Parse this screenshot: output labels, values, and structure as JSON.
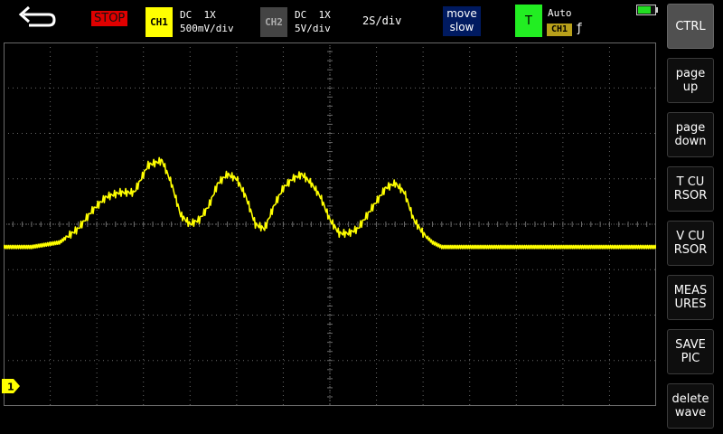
{
  "status": {
    "run_state": "STOP",
    "battery_level": 0.8
  },
  "ch1": {
    "label": "CH1",
    "coupling": "DC  1X",
    "scale": "500mV/div",
    "color": "#ffff00",
    "marker": "1"
  },
  "ch2": {
    "label": "CH2",
    "coupling": "DC  1X",
    "scale": "5V/div",
    "color": "#444444"
  },
  "timebase": "2S/div",
  "move_speed": {
    "line1": "move",
    "line2": "slow"
  },
  "trigger": {
    "badge": "T",
    "mode": "Auto",
    "source": "CH1",
    "edge": "ƒ"
  },
  "sidebar": {
    "items": [
      {
        "label": "CTRL",
        "active": true
      },
      {
        "label": "page\nup"
      },
      {
        "label": "page\ndown"
      },
      {
        "label": "T CU\nRSOR"
      },
      {
        "label": "V CU\nRSOR"
      },
      {
        "label": "MEAS\nURES"
      },
      {
        "label": "SAVE\nPIC"
      },
      {
        "label": "delete\nwave"
      }
    ]
  },
  "colors": {
    "grid": "#6a6a6a",
    "background": "#000000",
    "stop": "#e00000",
    "trigger": "#22ee22"
  },
  "chart_data": {
    "type": "line",
    "xlabel": "",
    "ylabel": "",
    "x_divisions": 14,
    "y_divisions": 8,
    "x_unit": "div",
    "y_unit": "div from CH1 ground",
    "xlim": [
      0,
      14
    ],
    "ylim": [
      -3.5,
      4.5
    ],
    "series": [
      {
        "x": [
          0,
          0.6,
          1.2,
          1.6,
          1.9,
          2.2,
          2.5,
          2.8,
          3.1,
          3.4,
          3.6,
          3.8,
          4.0,
          4.2,
          4.4,
          4.6,
          4.8,
          5.0,
          5.2,
          5.4,
          5.6,
          5.8,
          6.0,
          6.2,
          6.4,
          6.6,
          6.8,
          7.0,
          7.2,
          7.4,
          7.6,
          7.8,
          8.0,
          8.2,
          8.4,
          8.6,
          8.8,
          9.0,
          9.2,
          9.4,
          9.6,
          9.8,
          10.0,
          10.4,
          10.8,
          11.4,
          12.0,
          13.0,
          14.0
        ],
        "y": [
          0.0,
          0.0,
          0.1,
          0.4,
          0.8,
          1.1,
          1.2,
          1.2,
          1.8,
          1.9,
          1.4,
          0.7,
          0.5,
          0.6,
          0.9,
          1.4,
          1.6,
          1.5,
          1.1,
          0.5,
          0.4,
          0.9,
          1.3,
          1.5,
          1.6,
          1.4,
          1.1,
          0.6,
          0.3,
          0.3,
          0.4,
          0.7,
          1.0,
          1.3,
          1.4,
          1.2,
          0.6,
          0.3,
          0.1,
          0.0,
          0.0,
          0.0,
          0.0,
          0.0,
          0.0,
          0.0,
          0.0,
          0.0,
          0.0
        ]
      }
    ]
  }
}
